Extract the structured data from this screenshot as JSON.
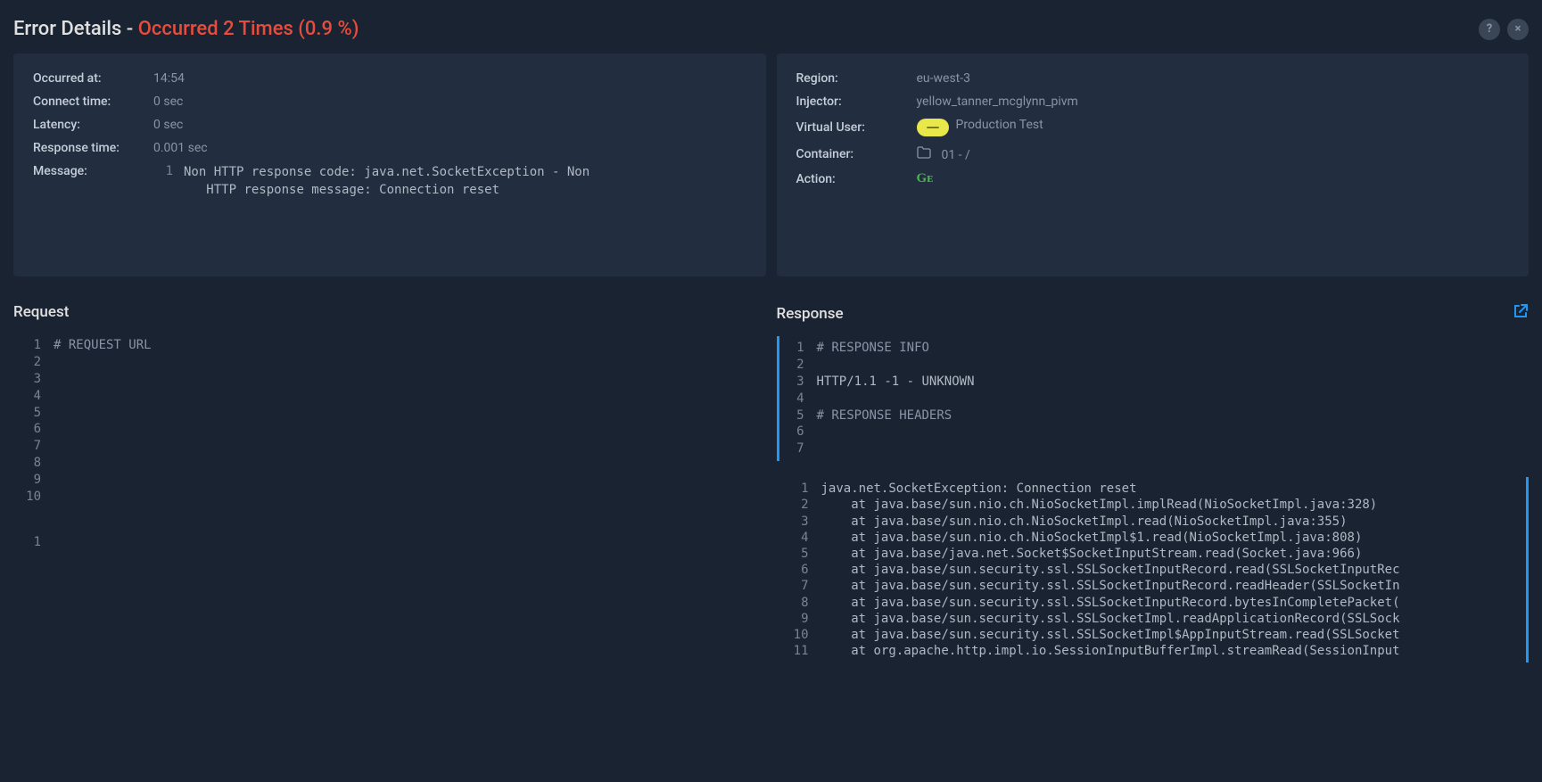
{
  "header": {
    "title_prefix": "Error Details - ",
    "title_highlight": "Occurred 2 Times (0.9 %)"
  },
  "left_panel": {
    "fields": [
      {
        "label": "Occurred at:",
        "value": "14:54"
      },
      {
        "label": "Connect time:",
        "value": "0 sec"
      },
      {
        "label": "Latency:",
        "value": "0 sec"
      },
      {
        "label": "Response time:",
        "value": "0.001 sec"
      }
    ],
    "message_label": "Message:",
    "message_lineno": "1",
    "message_text": "Non HTTP response code: java.net.SocketException - Non\n   HTTP response message: Connection reset"
  },
  "right_panel": {
    "fields": [
      {
        "label": "Region:",
        "value": "eu-west-3"
      },
      {
        "label": "Injector:",
        "value": "yellow_tanner_mcglynn_pivm"
      }
    ],
    "virtual_user_label": "Virtual User:",
    "virtual_user_value": "Production Test",
    "container_label": "Container:",
    "container_value": "01 - /",
    "action_label": "Action:",
    "action_value": "Gᴇ"
  },
  "request": {
    "title": "Request",
    "lines": [
      {
        "n": "1",
        "t": "# REQUEST URL",
        "comment": true
      },
      {
        "n": "2",
        "t": ""
      },
      {
        "n": "3",
        "t": ""
      },
      {
        "n": "4",
        "t": ""
      },
      {
        "n": "5",
        "t": ""
      },
      {
        "n": "6",
        "t": ""
      },
      {
        "n": "7",
        "t": ""
      },
      {
        "n": "8",
        "t": ""
      },
      {
        "n": "9",
        "t": ""
      },
      {
        "n": "10",
        "t": ""
      }
    ],
    "extra_lines": [
      {
        "n": "1",
        "t": ""
      }
    ]
  },
  "response": {
    "title": "Response",
    "lines": [
      {
        "n": "1",
        "t": "# RESPONSE INFO",
        "comment": true
      },
      {
        "n": "2",
        "t": ""
      },
      {
        "n": "3",
        "t": "HTTP/1.1 -1 - UNKNOWN"
      },
      {
        "n": "4",
        "t": ""
      },
      {
        "n": "5",
        "t": "# RESPONSE HEADERS",
        "comment": true
      },
      {
        "n": "6",
        "t": ""
      },
      {
        "n": "7",
        "t": ""
      }
    ],
    "stack": [
      {
        "n": "1",
        "t": "java.net.SocketException: Connection reset"
      },
      {
        "n": "2",
        "t": "    at java.base/sun.nio.ch.NioSocketImpl.implRead(NioSocketImpl.java:328)"
      },
      {
        "n": "3",
        "t": "    at java.base/sun.nio.ch.NioSocketImpl.read(NioSocketImpl.java:355)"
      },
      {
        "n": "4",
        "t": "    at java.base/sun.nio.ch.NioSocketImpl$1.read(NioSocketImpl.java:808)"
      },
      {
        "n": "5",
        "t": "    at java.base/java.net.Socket$SocketInputStream.read(Socket.java:966)"
      },
      {
        "n": "6",
        "t": "    at java.base/sun.security.ssl.SSLSocketInputRecord.read(SSLSocketInputRec"
      },
      {
        "n": "7",
        "t": "    at java.base/sun.security.ssl.SSLSocketInputRecord.readHeader(SSLSocketIn"
      },
      {
        "n": "8",
        "t": "    at java.base/sun.security.ssl.SSLSocketInputRecord.bytesInCompletePacket("
      },
      {
        "n": "9",
        "t": "    at java.base/sun.security.ssl.SSLSocketImpl.readApplicationRecord(SSLSock"
      },
      {
        "n": "10",
        "t": "    at java.base/sun.security.ssl.SSLSocketImpl$AppInputStream.read(SSLSocket"
      },
      {
        "n": "11",
        "t": "    at org.apache.http.impl.io.SessionInputBufferImpl.streamRead(SessionInput"
      }
    ]
  }
}
